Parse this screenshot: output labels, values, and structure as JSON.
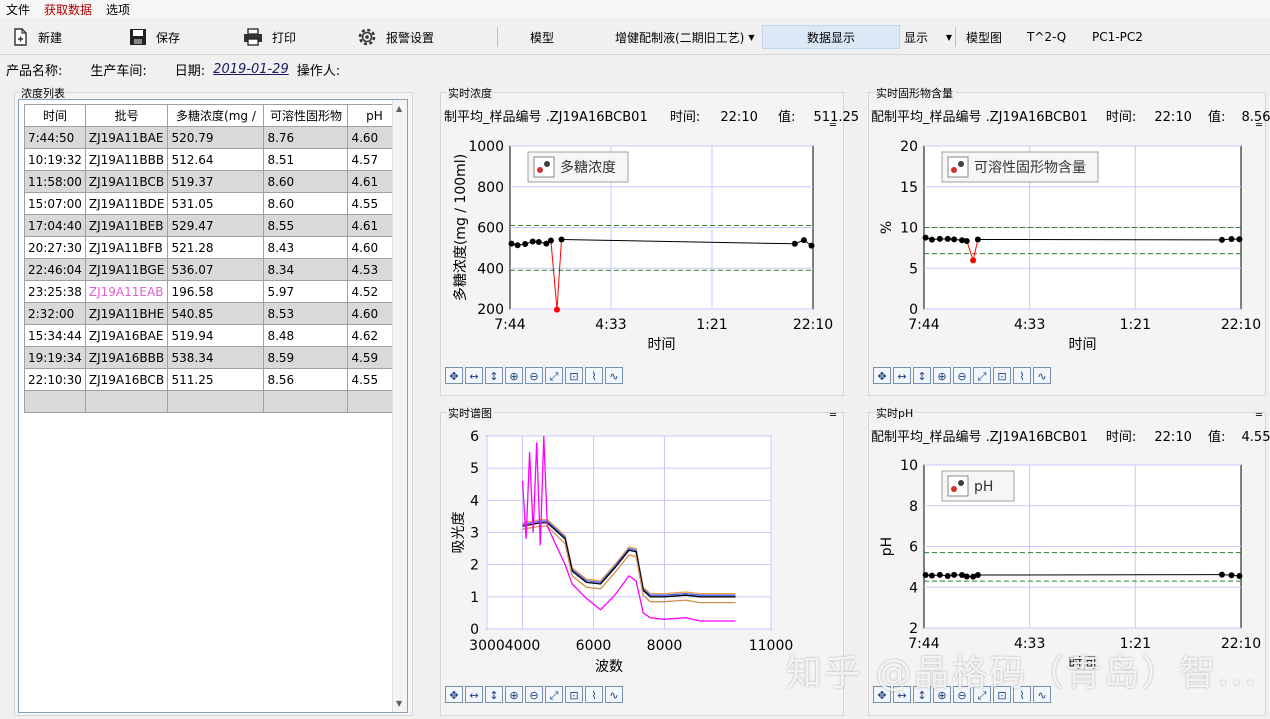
{
  "menu": [
    "文件",
    "获取数据",
    "选项"
  ],
  "toolbar": {
    "new_label": "新建",
    "save_label": "保存",
    "print_label": "打印",
    "alarm_label": "报警设置",
    "model_label": "模型",
    "model_select": "增健配制液(二期旧工艺)",
    "data_display_label": "数据显示",
    "display_select": "显示",
    "model_chart_label": "模型图",
    "t2q_label": "T^2-Q",
    "pc_label": "PC1-PC2"
  },
  "info": {
    "product_label": "产品名称:",
    "workshop_label": "生产车间:",
    "date_label": "日期:",
    "date_value": "2019-01-29",
    "operator_label": "操作人:"
  },
  "table": {
    "title": "浓度列表",
    "columns": [
      "时间",
      "批号",
      "多糖浓度(mg /",
      "可溶性固形物",
      "pH"
    ],
    "rows": [
      [
        "7:44:50",
        "ZJ19A11BAE",
        "520.79",
        "8.76",
        "4.60"
      ],
      [
        "10:19:32",
        "ZJ19A11BBB",
        "512.64",
        "8.51",
        "4.57"
      ],
      [
        "11:58:00",
        "ZJ19A11BCB",
        "519.37",
        "8.60",
        "4.61"
      ],
      [
        "15:07:00",
        "ZJ19A11BDE",
        "531.05",
        "8.60",
        "4.55"
      ],
      [
        "17:04:40",
        "ZJ19A11BEB",
        "529.47",
        "8.55",
        "4.61"
      ],
      [
        "20:27:30",
        "ZJ19A11BFB",
        "521.28",
        "8.43",
        "4.60"
      ],
      [
        "22:46:04",
        "ZJ19A11BGE",
        "536.07",
        "8.34",
        "4.53"
      ],
      [
        "23:25:38",
        "ZJ19A11EAB",
        "196.58",
        "5.97",
        "4.52"
      ],
      [
        "2:32:00",
        "ZJ19A11BHE",
        "540.85",
        "8.53",
        "4.60"
      ],
      [
        "15:34:44",
        "ZJ19A16BAE",
        "519.94",
        "8.48",
        "4.62"
      ],
      [
        "19:19:34",
        "ZJ19A16BBB",
        "538.34",
        "8.59",
        "4.59"
      ],
      [
        "22:10:30",
        "ZJ19A16BCB",
        "511.25",
        "8.56",
        "4.55"
      ],
      [
        "",
        "",
        "",
        "",
        ""
      ]
    ],
    "highlight_row": 7
  },
  "colors": {
    "series_line": "#000000",
    "outlier": "#ff0000",
    "limit_line": "#2e7d32",
    "grid": "#c8c8ff",
    "pink_text": "#e060d0",
    "spectrum_magenta": "#ff00ff"
  },
  "charts": {
    "conc": {
      "group_title": "实时浓度",
      "head_name": "制平均_样品编号 .ZJ19A16BCB01",
      "time_label": "时间:",
      "time_value": "22:10",
      "value_label": "值:",
      "value": "511.25",
      "legend": "多糖浓度",
      "xlabel": "时间",
      "ylabel": "多糖浓度(mg / 100ml)"
    },
    "solid": {
      "group_title": "实时固形物含量",
      "head_name": "配制平均_样品编号 .ZJ19A16BCB01",
      "time_label": "时间:",
      "time_value": "22:10",
      "value_label": "值:",
      "value": "8.56",
      "legend": "可溶性固形物含量",
      "xlabel": "时间",
      "ylabel": "%"
    },
    "spectrum": {
      "group_title": "实时谱图",
      "xlabel": "波数",
      "ylabel": "吸光度"
    },
    "ph": {
      "group_title": "实时pH",
      "head_name": "配制平均_样品编号 .ZJ19A16BCB01",
      "time_label": "时间:",
      "time_value": "22:10",
      "value_label": "值:",
      "value": "4.55",
      "legend": "pH",
      "xlabel": "时间",
      "ylabel": "pH"
    }
  },
  "chart_data": [
    {
      "type": "line",
      "id": "conc",
      "x_ticks": [
        "7:44",
        "4:33",
        "1:21",
        "22:10"
      ],
      "x_range": [
        0,
        100
      ],
      "ylim": [
        200,
        1000
      ],
      "y_ticks": [
        200,
        400,
        600,
        800,
        1000
      ],
      "upper_limit": 610,
      "lower_limit": 390,
      "points": [
        [
          0.5,
          521
        ],
        [
          2.5,
          513
        ],
        [
          5,
          519
        ],
        [
          7.5,
          531
        ],
        [
          9.5,
          529
        ],
        [
          12,
          521
        ],
        [
          13.5,
          536
        ],
        [
          15.5,
          197
        ],
        [
          17,
          541
        ],
        [
          94,
          520
        ],
        [
          97,
          538
        ],
        [
          99.5,
          511
        ]
      ],
      "outliers": [
        [
          15.5,
          197
        ]
      ],
      "xlabel": "时间",
      "ylabel": "多糖浓度(mg / 100ml)",
      "legend": [
        "多糖浓度"
      ]
    },
    {
      "type": "line",
      "id": "solid",
      "x_ticks": [
        "7:44",
        "4:33",
        "1:21",
        "22:10"
      ],
      "x_range": [
        0,
        100
      ],
      "ylim": [
        0,
        20
      ],
      "y_ticks": [
        0,
        5,
        10,
        15,
        20
      ],
      "upper_limit": 10,
      "lower_limit": 6.8,
      "points": [
        [
          0.5,
          8.76
        ],
        [
          2.5,
          8.51
        ],
        [
          5,
          8.6
        ],
        [
          7.5,
          8.6
        ],
        [
          9.5,
          8.55
        ],
        [
          12,
          8.43
        ],
        [
          13.5,
          8.34
        ],
        [
          15.5,
          5.97
        ],
        [
          17,
          8.53
        ],
        [
          94,
          8.48
        ],
        [
          97,
          8.59
        ],
        [
          99.5,
          8.56
        ]
      ],
      "outliers": [
        [
          15.5,
          5.97
        ]
      ],
      "xlabel": "时间",
      "ylabel": "%",
      "legend": [
        "可溶性固形物含量"
      ]
    },
    {
      "type": "line",
      "id": "spectrum",
      "xlim": [
        3000,
        11000
      ],
      "x_ticks": [
        3000,
        4000,
        6000,
        8000,
        11000
      ],
      "ylim": [
        0,
        6
      ],
      "y_ticks": [
        0,
        1,
        2,
        3,
        4,
        5,
        6
      ],
      "xlabel": "波数",
      "ylabel": "吸光度",
      "series": [
        {
          "color": "#f0a040",
          "x": [
            4000,
            4500,
            4700,
            5200,
            5400,
            5800,
            6200,
            6600,
            7000,
            7200,
            7400,
            7600,
            8000,
            8600,
            9000,
            9500,
            10000
          ],
          "y": [
            3.3,
            3.4,
            3.4,
            2.9,
            1.9,
            1.55,
            1.5,
            2.0,
            2.55,
            2.5,
            1.3,
            1.1,
            1.1,
            1.15,
            1.1,
            1.1,
            1.1
          ]
        },
        {
          "color": "#4060ff",
          "x": [
            4000,
            4500,
            4700,
            5200,
            5400,
            5800,
            6200,
            6600,
            7000,
            7200,
            7400,
            7600,
            8000,
            8600,
            9000,
            9500,
            10000
          ],
          "y": [
            3.25,
            3.35,
            3.35,
            2.85,
            1.85,
            1.5,
            1.45,
            1.95,
            2.5,
            2.45,
            1.25,
            1.05,
            1.05,
            1.1,
            1.05,
            1.05,
            1.05
          ]
        },
        {
          "color": "#000000",
          "x": [
            4000,
            4500,
            4700,
            5200,
            5400,
            5800,
            6200,
            6600,
            7000,
            7200,
            7400,
            7600,
            8000,
            8600,
            9000,
            9500,
            10000
          ],
          "y": [
            3.2,
            3.3,
            3.3,
            2.8,
            1.8,
            1.45,
            1.4,
            1.9,
            2.45,
            2.4,
            1.2,
            1.0,
            1.0,
            1.05,
            1.0,
            1.0,
            1.0
          ]
        },
        {
          "color": "#d09050",
          "x": [
            4000,
            4500,
            4700,
            5200,
            5400,
            5800,
            6200,
            6600,
            7000,
            7200,
            7400,
            7600,
            8000,
            8600,
            9000,
            9500,
            10000
          ],
          "y": [
            3.1,
            3.2,
            3.2,
            2.65,
            1.65,
            1.3,
            1.25,
            1.75,
            2.3,
            2.25,
            1.05,
            0.85,
            0.85,
            0.9,
            0.82,
            0.82,
            0.82
          ]
        },
        {
          "color": "#ff00ff",
          "x": [
            4000,
            4100,
            4200,
            4300,
            4400,
            4500,
            4600,
            4700,
            5200,
            5400,
            5800,
            6200,
            6600,
            7000,
            7200,
            7400,
            7600,
            8000,
            8600,
            9000,
            9500,
            10000
          ],
          "y": [
            4.6,
            2.8,
            5.5,
            3.0,
            5.8,
            2.6,
            6.0,
            3.2,
            2.0,
            1.4,
            0.95,
            0.6,
            1.05,
            1.65,
            1.5,
            0.5,
            0.35,
            0.3,
            0.35,
            0.25,
            0.25,
            0.25
          ]
        }
      ]
    },
    {
      "type": "line",
      "id": "ph",
      "x_ticks": [
        "7:44",
        "4:33",
        "1:21",
        "22:10"
      ],
      "x_range": [
        0,
        100
      ],
      "ylim": [
        2,
        10
      ],
      "y_ticks": [
        2,
        4,
        6,
        8,
        10
      ],
      "upper_limit": 5.7,
      "lower_limit": 4.3,
      "points": [
        [
          0.5,
          4.6
        ],
        [
          2.5,
          4.57
        ],
        [
          5,
          4.61
        ],
        [
          7.5,
          4.55
        ],
        [
          9.5,
          4.61
        ],
        [
          12,
          4.6
        ],
        [
          13.5,
          4.53
        ],
        [
          15.5,
          4.52
        ],
        [
          17,
          4.6
        ],
        [
          94,
          4.62
        ],
        [
          97,
          4.59
        ],
        [
          99.5,
          4.55
        ]
      ],
      "outliers": [],
      "xlabel": "时间",
      "ylabel": "pH",
      "legend": [
        "pH"
      ]
    }
  ],
  "watermark": "知乎 @晶格码（青岛）智..."
}
